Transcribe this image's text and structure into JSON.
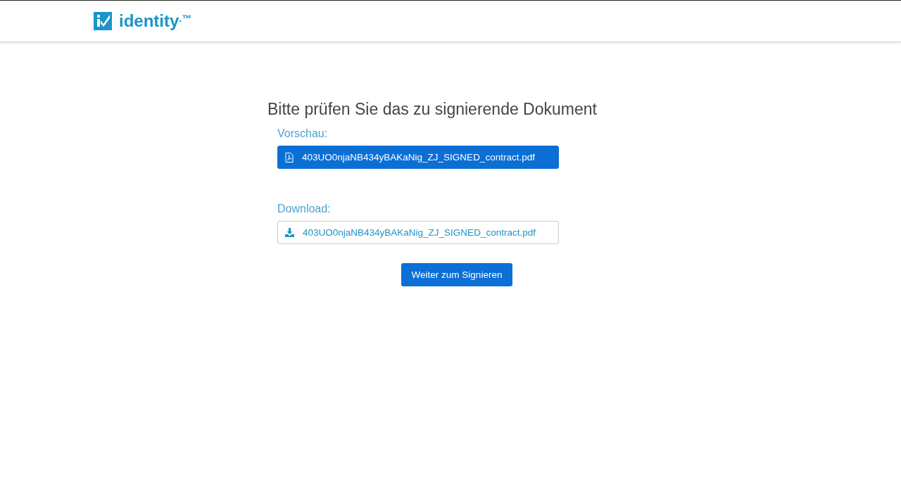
{
  "header": {
    "brand": "identity",
    "trademark": ".™"
  },
  "title": "Bitte prüfen Sie das zu signierende Dokument",
  "sections": [
    {
      "kind": "preview",
      "label": "Vorschau:",
      "file": "403UO0njaNB434yBAKaNig_ZJ_SIGNED_contract.pdf"
    },
    {
      "kind": "download",
      "label": "Download:",
      "file": "403UO0njaNB434yBAKaNig_ZJ_SIGNED_contract.pdf"
    }
  ],
  "primary_button": "Weiter zum Signieren"
}
